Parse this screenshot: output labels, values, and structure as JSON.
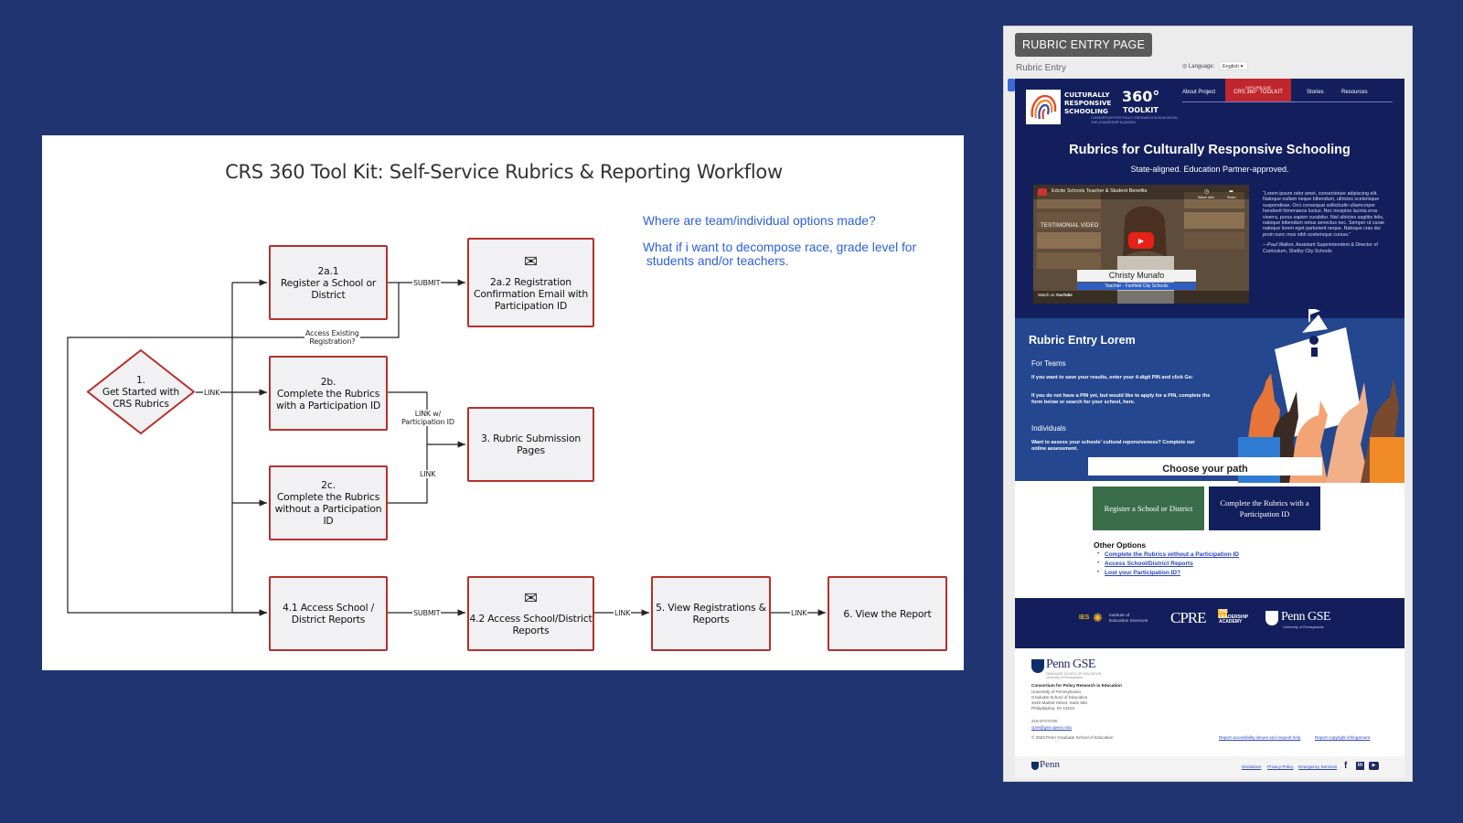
{
  "diagram": {
    "title": "CRS 360 Tool Kit: Self-Service Rubrics & Reporting Workflow",
    "notes": [
      "Where are team/individual options made?",
      "What if i want to decompose race, grade level for\n students and/or teachers."
    ],
    "start": {
      "line1": "1.",
      "line2": "Get Started with",
      "line3": "CRS Rubrics"
    },
    "boxes": {
      "register": "2a.1\nRegister a School or\nDistrict",
      "confirmation": "2a.2 Registration\nConfirmation Email with\nParticipation ID",
      "with_id": "2b.\nComplete the Rubrics\nwith a Participation ID",
      "submission": "3. Rubric Submission\nPages",
      "without_id": "2c.\nComplete the Rubrics\nwithout a Participation\nID",
      "access_reports": "4.1 Access School /\nDistrict Reports",
      "access_reports_2": "4.2 Access School/District\nReports",
      "view_registrations": "5. View Registrations &\nReports",
      "view_report": "6. View the Report"
    },
    "edge_labels": {
      "submit_1": "SUBMIT",
      "access_existing": "Access Existing\nRegistration?",
      "link_start": "LINK",
      "link_with_id": "LINK w/\nParticipation ID",
      "link_without": "LINK",
      "submit_2": "SUBMIT",
      "link_5": "LINK",
      "link_6": "LINK"
    },
    "colors": {
      "box_border": "#b5302c",
      "box_fill": "#f1f1f3",
      "note": "#2a60df",
      "edge": "#222222"
    }
  },
  "rubric_page": {
    "tag": "RUBRIC ENTRY PAGE",
    "subtitle": "Rubric Entry",
    "language_label": "Language:",
    "language_value": "English",
    "logo": {
      "line1": "CULTURALLY",
      "line2": "RESPONSIVE",
      "line3": "SCHOOLING",
      "big": "360°",
      "toolkit": "TOOLKIT",
      "tag1": "CONSORTIUM FOR POLICY RESEARCH IN EDUCATION",
      "tag2": "THE LEADERSHIP ACADEMY"
    },
    "nav": {
      "about": "About Project",
      "explore_small": "EXPLORE OUR",
      "explore": "CRS 360° TOOLKIT",
      "stories": "Stories",
      "resources": "Resources"
    },
    "hero_title": "Rubrics for Culturally Responsive Schooling",
    "hero_sub": "State-aligned. Education Partner-approved.",
    "video": {
      "title": "Edcite Schools Teacher & Student Benefits",
      "watch_later": "Watch later",
      "share": "Share",
      "badge": "TESTIMONIAL VIDEO",
      "name": "Christy Munafo",
      "role": "Teacher - Fairfield City Schools",
      "watch_on": "Watch on",
      "youtube": "YouTube"
    },
    "quote": "“Lorem ipsum odor amet, consectetuer adipiscing elit. Natoque nullam neque bibendum, ultricies scelerisque suspendisse. Orci consequat sollicitudin ullamcorper hendrerit himenaeos luctus. Nec inceptos lacinia eros viverra, purus sapien curabitur. Nisl ultricies sagittis felis, natoque bibendum netus senectus nec. Semper ut curae natoque lorem eget parturient neque. Natoque cras dui proin nunc mus nibh scelerisque cursus.”",
    "quote_author": "—Paul Walker, Assistant Superintendent & Director of Curriculum, Shelby City Schools",
    "entry_title": "Rubric Entry Lorem",
    "for_teams": "For Teams",
    "teams_p1": "If you want to save your results, enter your 4-digit PIN and click Go:",
    "teams_p2": "If you do not have a PIN yet, but would like to apply for a PIN, complete the form below or search for your school, here.",
    "individuals": "Individuals",
    "ind_p": "Want to assess your schools' cultural reponsiveness? Complete our online assessment.",
    "choose_path": "Choose your path",
    "btn_register": "Register a School or District",
    "btn_complete": "Complete the Rubrics with a Participation ID",
    "other_title": "Other Options",
    "other_links": [
      "Complete the Rubrics without a Participation ID",
      "Access School/District Reports",
      "Lost your Participation ID?"
    ],
    "partners": {
      "ies": "IES",
      "ies_text": "Institute of\nEducation Sciences",
      "cpre": "CPRE",
      "tla": "THE\nLEADERSHIP\nACADEMY",
      "penn": "Penn GSE",
      "penn_sub": "University of Pennsylvania"
    },
    "footer": {
      "logo": "Penn GSE",
      "logo_sub": "GRADUATE SCHOOL OF EDUCATION\nUniversity of Pennsylvania",
      "org": "Consortium for Policy Research in Education",
      "addr": "University of Pennsylvania\nGraduate School of Education\n3440 Market Street, Suite 560\nPhiladelphia, PA 19104",
      "phone": "215-573-0700",
      "email": "cpre@gse.upenn.edu",
      "copyright": "© 2023 Penn Graduate School of Education",
      "report_access": "Report accessibility issues and request help",
      "report_copy": "Report copyright infringement",
      "penn": "Penn",
      "disclaimer": "Disclaimer",
      "privacy": "Privacy Policy",
      "emergency": "Emergency Services"
    }
  }
}
